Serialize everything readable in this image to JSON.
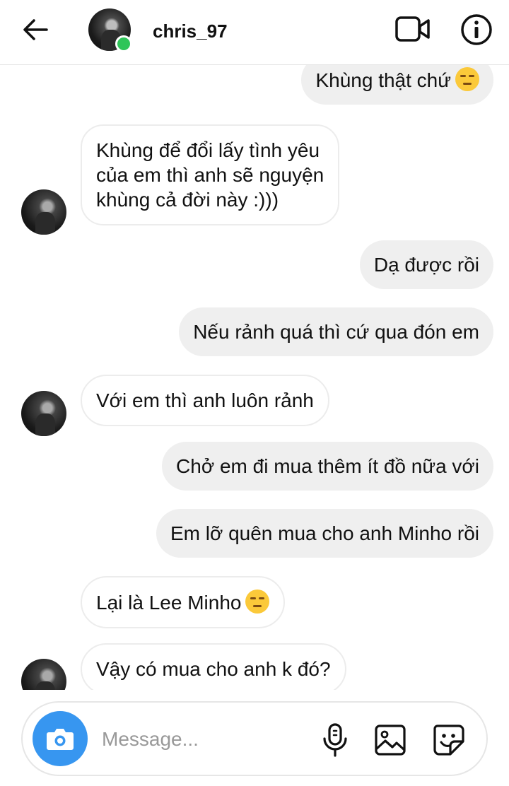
{
  "header": {
    "username": "chris_97",
    "icons": [
      "back-arrow-icon",
      "avatar",
      "online-status-dot",
      "video-call-icon",
      "info-icon"
    ]
  },
  "composer": {
    "placeholder": "Message...",
    "icons": [
      "camera-icon",
      "microphone-icon",
      "gallery-icon",
      "sticker-icon"
    ]
  },
  "messages": [
    {
      "sender": "me",
      "text": "Khùng thật chứ",
      "emoji": "unamused-face"
    },
    {
      "sender": "chris_97",
      "lines": [
        "Khùng để đổi lấy tình yêu",
        "của em thì anh sẽ nguyện",
        "khùng cả đời này :)))"
      ]
    },
    {
      "sender": "me",
      "text": "Dạ được rồi"
    },
    {
      "sender": "me",
      "text": "Nếu rảnh quá thì cứ qua đón em"
    },
    {
      "sender": "chris_97",
      "text": "Với em thì anh luôn rảnh"
    },
    {
      "sender": "me",
      "text": "Chở em đi mua thêm ít đồ nữa với"
    },
    {
      "sender": "me",
      "text": "Em lỡ quên mua cho anh Minho rồi"
    },
    {
      "sender": "chris_97",
      "text": "Lại là Lee Minho",
      "emoji": "unamused-face"
    },
    {
      "sender": "chris_97",
      "text": "Vậy có mua cho anh k đó?"
    }
  ],
  "colors": {
    "accent": "#3796f0",
    "online": "#2fc559",
    "my_bubble": "#efefef",
    "their_bubble_border": "#ececec"
  }
}
